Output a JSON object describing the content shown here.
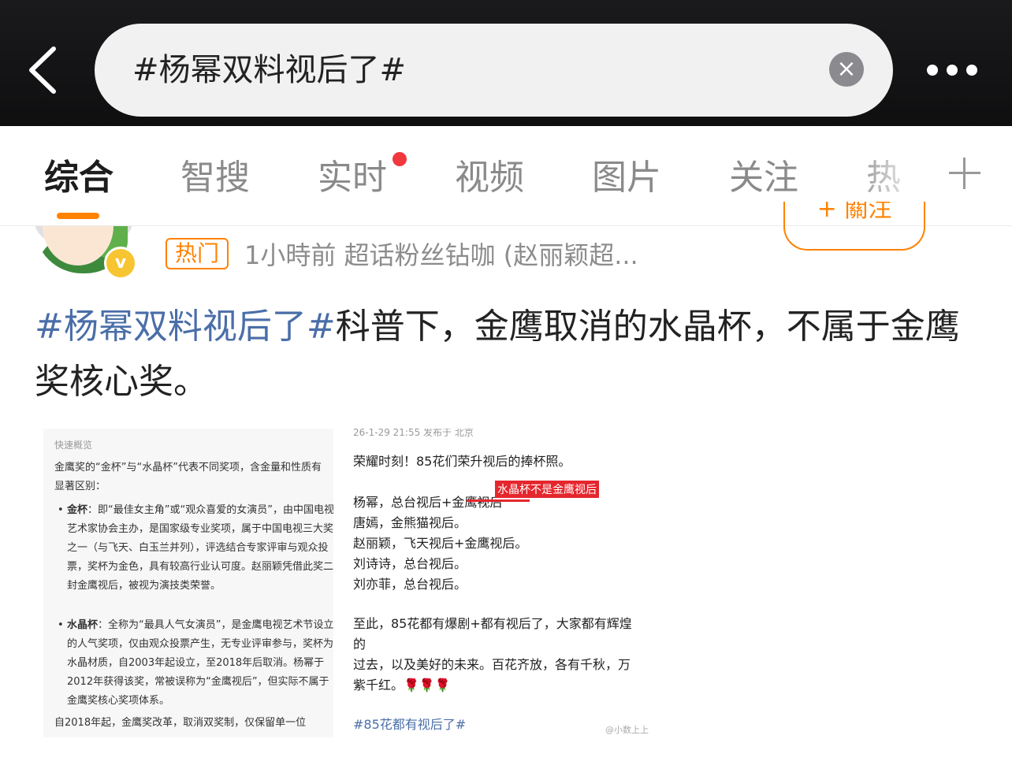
{
  "search": {
    "query": "#杨幂双料视后了#",
    "clear_icon": "close-circle-icon"
  },
  "tabs": [
    {
      "label": "综合",
      "active": true
    },
    {
      "label": "智搜"
    },
    {
      "label": "实时",
      "dot": true
    },
    {
      "label": "视频"
    },
    {
      "label": "图片"
    },
    {
      "label": "关注"
    },
    {
      "label": "热"
    }
  ],
  "post": {
    "follow_label": "+ 關注",
    "hot_tag": "热门",
    "meta": "1小時前  超话粉丝钻咖 (赵丽颖超...",
    "topic": "#杨幂双料视后了#",
    "text": "科普下，金鹰取消的水晶杯，不属于金鹰奖核心奖。"
  },
  "image_left": {
    "head": "快速概览",
    "intro": "金鹰奖的“金杯”与“水晶杯”代表不同奖项，含金量和性质有显著区别：",
    "b1_title": "金杯",
    "b1_text": "：即“最佳女主角”或“观众喜爱的女演员”，由中国电视艺术家协会主办，是国家级专业奖项，属于中国电视三大奖之一（与飞天、白玉兰并列），评选结合专家评审与观众投票，奖杯为金色，具有较高行业认可度。赵丽颖凭借此奖二封金鹰视后，被视为演技类荣誉。",
    "b2_title": "水晶杯",
    "b2_text": "：全称为“最具人气女演员”，是金鹰电视艺术节设立的人气奖项，仅由观众投票产生，无专业评审参与，奖杯为水晶材质，自2003年起设立，至2018年后取消。杨幂于2012年获得该奖，常被误称为“金鹰视后”，但实际不属于金鹰奖核心奖项体系。",
    "tail": "自2018年起，金鹰奖改革，取消双奖制，仅保留单一位"
  },
  "image_right": {
    "top": "26-1-29 21:55  发布于 北京",
    "l1": "荣耀时刻！85花们荣升视后的捧杯照。",
    "l2": "杨幂，总台视后+金鹰视后",
    "mark": "水晶杯不是金鹰视后",
    "l3": "唐嫣，金熊猫视后。",
    "l4": "赵丽颖，飞天视后+金鹰视后。",
    "l5": "刘诗诗，总台视后。",
    "l6": "刘亦菲，总台视后。",
    "l7": "至此，85花都有爆剧+都有视后了，大家都有辉煌",
    "l8": "的",
    "l9": "过去，以及美好的未来。百花齐放，各有千秋，万",
    "l10": "紫千红。🌹🌹🌹",
    "topic": "#85花都有视后了#",
    "watermark": "@小数上上"
  }
}
